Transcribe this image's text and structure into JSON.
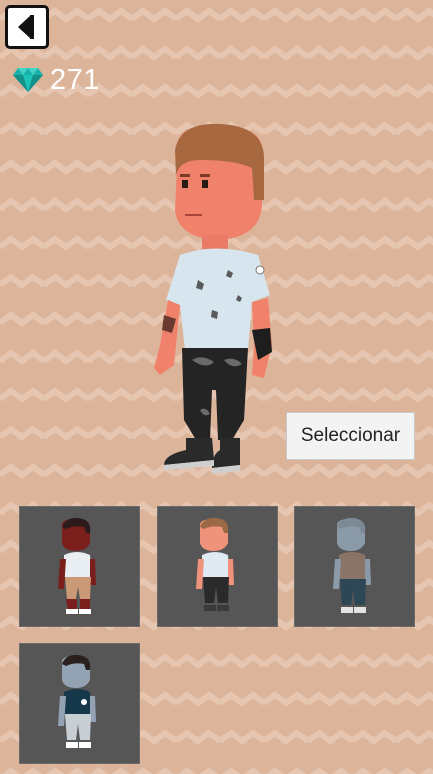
{
  "header": {
    "back_icon": "back-arrow-icon",
    "gem_icon": "diamond-icon",
    "gem_count": "271"
  },
  "actions": {
    "select_label": "Seleccionar"
  },
  "colors": {
    "background": "#dcb49a",
    "zigzag": "#e6c6b0",
    "gem": "#1ab1a8",
    "slot_bg": "#565656"
  },
  "characters": [
    {
      "skin": "#7a1f1c",
      "hair": "#2d1b1b",
      "shirt": "#e8eef2",
      "pants": "#c99a75"
    },
    {
      "skin": "#f0937c",
      "hair": "#9b6a45",
      "shirt": "#dfeaf2",
      "pants": "#2a2a2a"
    },
    {
      "skin": "#8a9aa8",
      "hair": "#7d8a95",
      "shirt": "#8a7468",
      "pants": "#2e4756"
    },
    {
      "skin": "#93a3b3",
      "hair": "#2b2020",
      "shirt": "#15384a",
      "pants": "#c8cfd4"
    }
  ]
}
